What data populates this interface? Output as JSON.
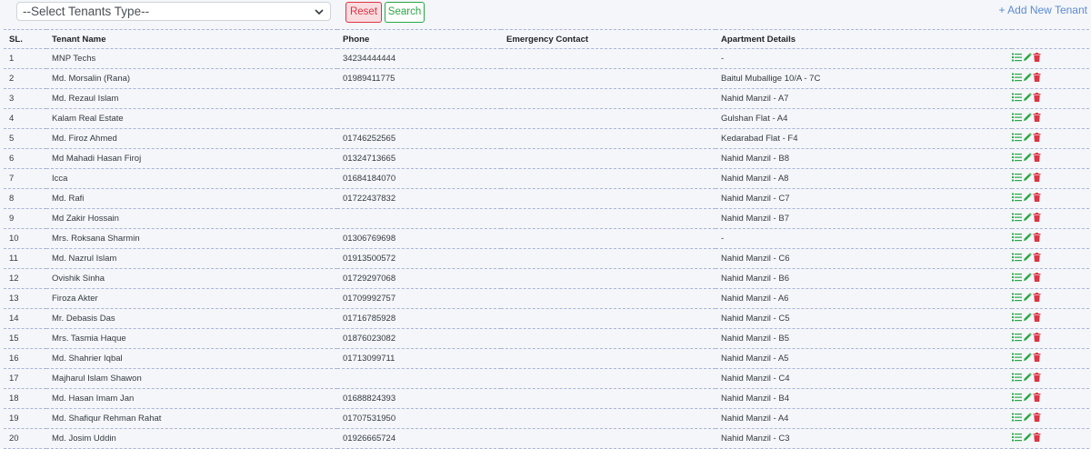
{
  "toolbar": {
    "select_value": "--Select Tenants Type--",
    "reset_label": "Reset",
    "search_label": "Search",
    "add_label": "+ Add New Tenant"
  },
  "table": {
    "headers": [
      "SL.",
      "Tenant Name",
      "Phone",
      "Emergency Contact",
      "Apartment Details"
    ],
    "rows": [
      {
        "sl": "1",
        "name": "MNP Techs",
        "phone": "34234444444",
        "emergency": "",
        "apartment": "-"
      },
      {
        "sl": "2",
        "name": "Md. Morsalin (Rana)",
        "phone": "01989411775",
        "emergency": "",
        "apartment": "Baitul Muballige 10/A - 7C"
      },
      {
        "sl": "3",
        "name": "Md. Rezaul Islam",
        "phone": "",
        "emergency": "",
        "apartment": "Nahid Manzil - A7"
      },
      {
        "sl": "4",
        "name": "Kalam Real Estate",
        "phone": "",
        "emergency": "",
        "apartment": "Gulshan Flat - A4"
      },
      {
        "sl": "5",
        "name": "Md. Firoz Ahmed",
        "phone": "01746252565",
        "emergency": "",
        "apartment": "Kedarabad Flat - F4"
      },
      {
        "sl": "6",
        "name": "Md Mahadi Hasan Firoj",
        "phone": "01324713665",
        "emergency": "",
        "apartment": "Nahid Manzil - B8"
      },
      {
        "sl": "7",
        "name": "Icca",
        "phone": "01684184070",
        "emergency": "",
        "apartment": "Nahid Manzil - A8"
      },
      {
        "sl": "8",
        "name": "Md. Rafi",
        "phone": "01722437832",
        "emergency": "",
        "apartment": "Nahid Manzil - C7"
      },
      {
        "sl": "9",
        "name": "Md Zakir Hossain",
        "phone": "",
        "emergency": "",
        "apartment": "Nahid Manzil - B7"
      },
      {
        "sl": "10",
        "name": "Mrs. Roksana Sharmin",
        "phone": "01306769698",
        "emergency": "",
        "apartment": "-"
      },
      {
        "sl": "11",
        "name": "Md. Nazrul Islam",
        "phone": "01913500572",
        "emergency": "",
        "apartment": "Nahid Manzil - C6"
      },
      {
        "sl": "12",
        "name": "Ovishik Sinha",
        "phone": "01729297068",
        "emergency": "",
        "apartment": "Nahid Manzil - B6"
      },
      {
        "sl": "13",
        "name": "Firoza Akter",
        "phone": "01709992757",
        "emergency": "",
        "apartment": "Nahid Manzil - A6"
      },
      {
        "sl": "14",
        "name": "Mr. Debasis Das",
        "phone": "01716785928",
        "emergency": "",
        "apartment": "Nahid Manzil - C5"
      },
      {
        "sl": "15",
        "name": "Mrs. Tasmia Haque",
        "phone": "01876023082",
        "emergency": "",
        "apartment": "Nahid Manzil - B5"
      },
      {
        "sl": "16",
        "name": "Md. Shahrier Iqbal",
        "phone": "01713099711",
        "emergency": "",
        "apartment": "Nahid Manzil - A5"
      },
      {
        "sl": "17",
        "name": "Majharul Islam Shawon",
        "phone": "",
        "emergency": "",
        "apartment": "Nahid Manzil - C4"
      },
      {
        "sl": "18",
        "name": "Md. Hasan Imam Jan",
        "phone": "01688824393",
        "emergency": "",
        "apartment": "Nahid Manzil - B4"
      },
      {
        "sl": "19",
        "name": "Md. Shafiqur Rehman Rahat",
        "phone": "01707531950",
        "emergency": "",
        "apartment": "Nahid Manzil - A4"
      },
      {
        "sl": "20",
        "name": "Md. Josim Uddin",
        "phone": "01926665724",
        "emergency": "",
        "apartment": "Nahid Manzil - C3"
      }
    ],
    "row_actions": [
      "list-icon",
      "edit-pencil-icon",
      "delete-trash-icon"
    ]
  },
  "colors": {
    "list_icon": "#28a745",
    "edit_icon": "#28a745",
    "delete_icon": "#dc3545",
    "link": "#5c8bd4",
    "divider": "#aab5d6"
  }
}
